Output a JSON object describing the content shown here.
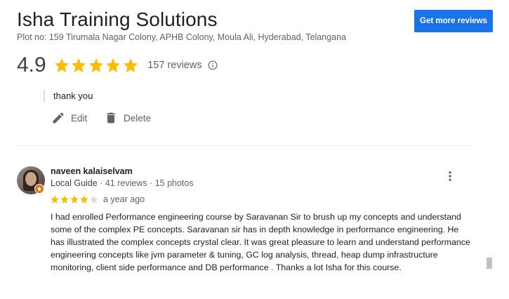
{
  "business": {
    "name": "Isha Training Solutions",
    "address": "Plot no: 159 Tirumala Nagar Colony, APHB Colony, Moula Ali, Hyderabad, Telangana",
    "rating": "4.9",
    "rating_stars": 5,
    "reviews_count": "157 reviews",
    "get_more_reviews_label": "Get more reviews"
  },
  "owner_reply": {
    "text": "thank you",
    "edit_label": "Edit",
    "delete_label": "Delete"
  },
  "review": {
    "reviewer_name": "naveen kalaiselvam",
    "guide_label": "Local Guide",
    "meta": "· 41 reviews · 15 photos",
    "stars": 4,
    "max_stars": 5,
    "time": "a year ago",
    "body": "I had enrolled Performance engineering course by Saravanan Sir to brush up my concepts and understand some of the complex PE concepts. Saravanan sir has in depth knowledge in performance engineering. He has illustrated the complex concepts crystal clear. It was great pleasure to learn and understand performance engineering concepts like jvm parameter & tuning, GC log analysis, thread, heap dump infrastructure monitoring, client side performance and DB performance . Thanks a lot Isha for this course."
  },
  "colors": {
    "star": "#fbbc04",
    "star_empty": "#dadce0",
    "accent": "#1a73e8",
    "guide_badge": "#e8710a"
  },
  "icons": [
    "info-icon",
    "edit-icon",
    "delete-icon",
    "more-vert-icon",
    "star-icon",
    "local-guide-badge-icon"
  ]
}
